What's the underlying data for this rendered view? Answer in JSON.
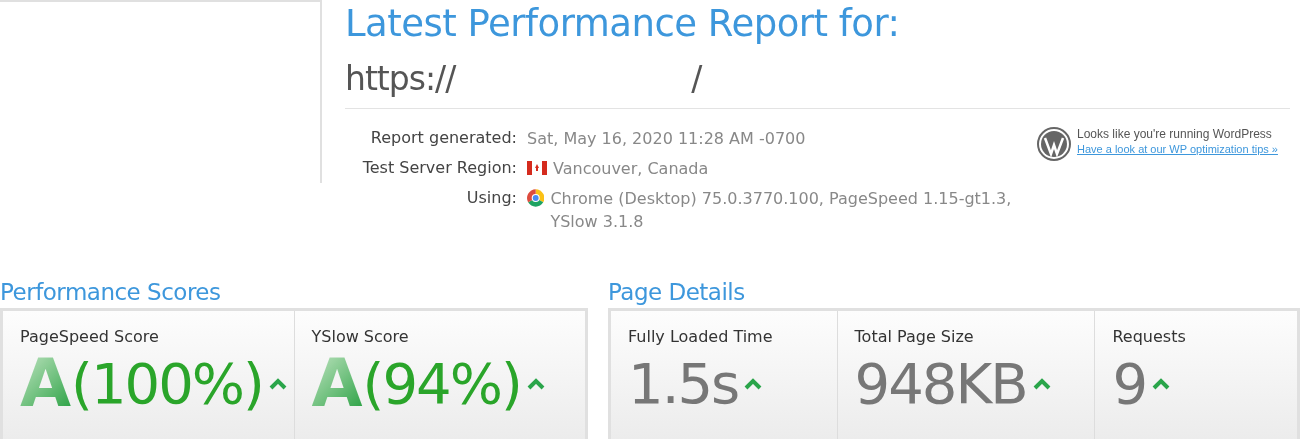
{
  "title": "Latest Performance Report for:",
  "url": {
    "prefix": "https://",
    "suffix": "/"
  },
  "info": [
    {
      "label": "Report generated:",
      "value": "Sat, May 16, 2020 11:28 AM -0700"
    },
    {
      "label": "Test Server Region:",
      "value": "Vancouver, Canada"
    },
    {
      "label": "Using:",
      "value": "Chrome (Desktop) 75.0.3770.100, PageSpeed 1.15-gt1.3, YSlow 3.1.8"
    }
  ],
  "wordpress": {
    "text": "Looks like you're running WordPress",
    "link": "Have a look at our WP optimization tips »"
  },
  "performance_scores": {
    "heading": "Performance Scores",
    "cards": [
      {
        "label": "PageSpeed Score",
        "grade": "A",
        "value": "(100%)"
      },
      {
        "label": "YSlow Score",
        "grade": "A",
        "value": "(94%)"
      }
    ]
  },
  "page_details": {
    "heading": "Page Details",
    "cards": [
      {
        "label": "Fully Loaded Time",
        "value": "1.5s"
      },
      {
        "label": "Total Page Size",
        "value": "948KB"
      },
      {
        "label": "Requests",
        "value": "9"
      }
    ]
  }
}
